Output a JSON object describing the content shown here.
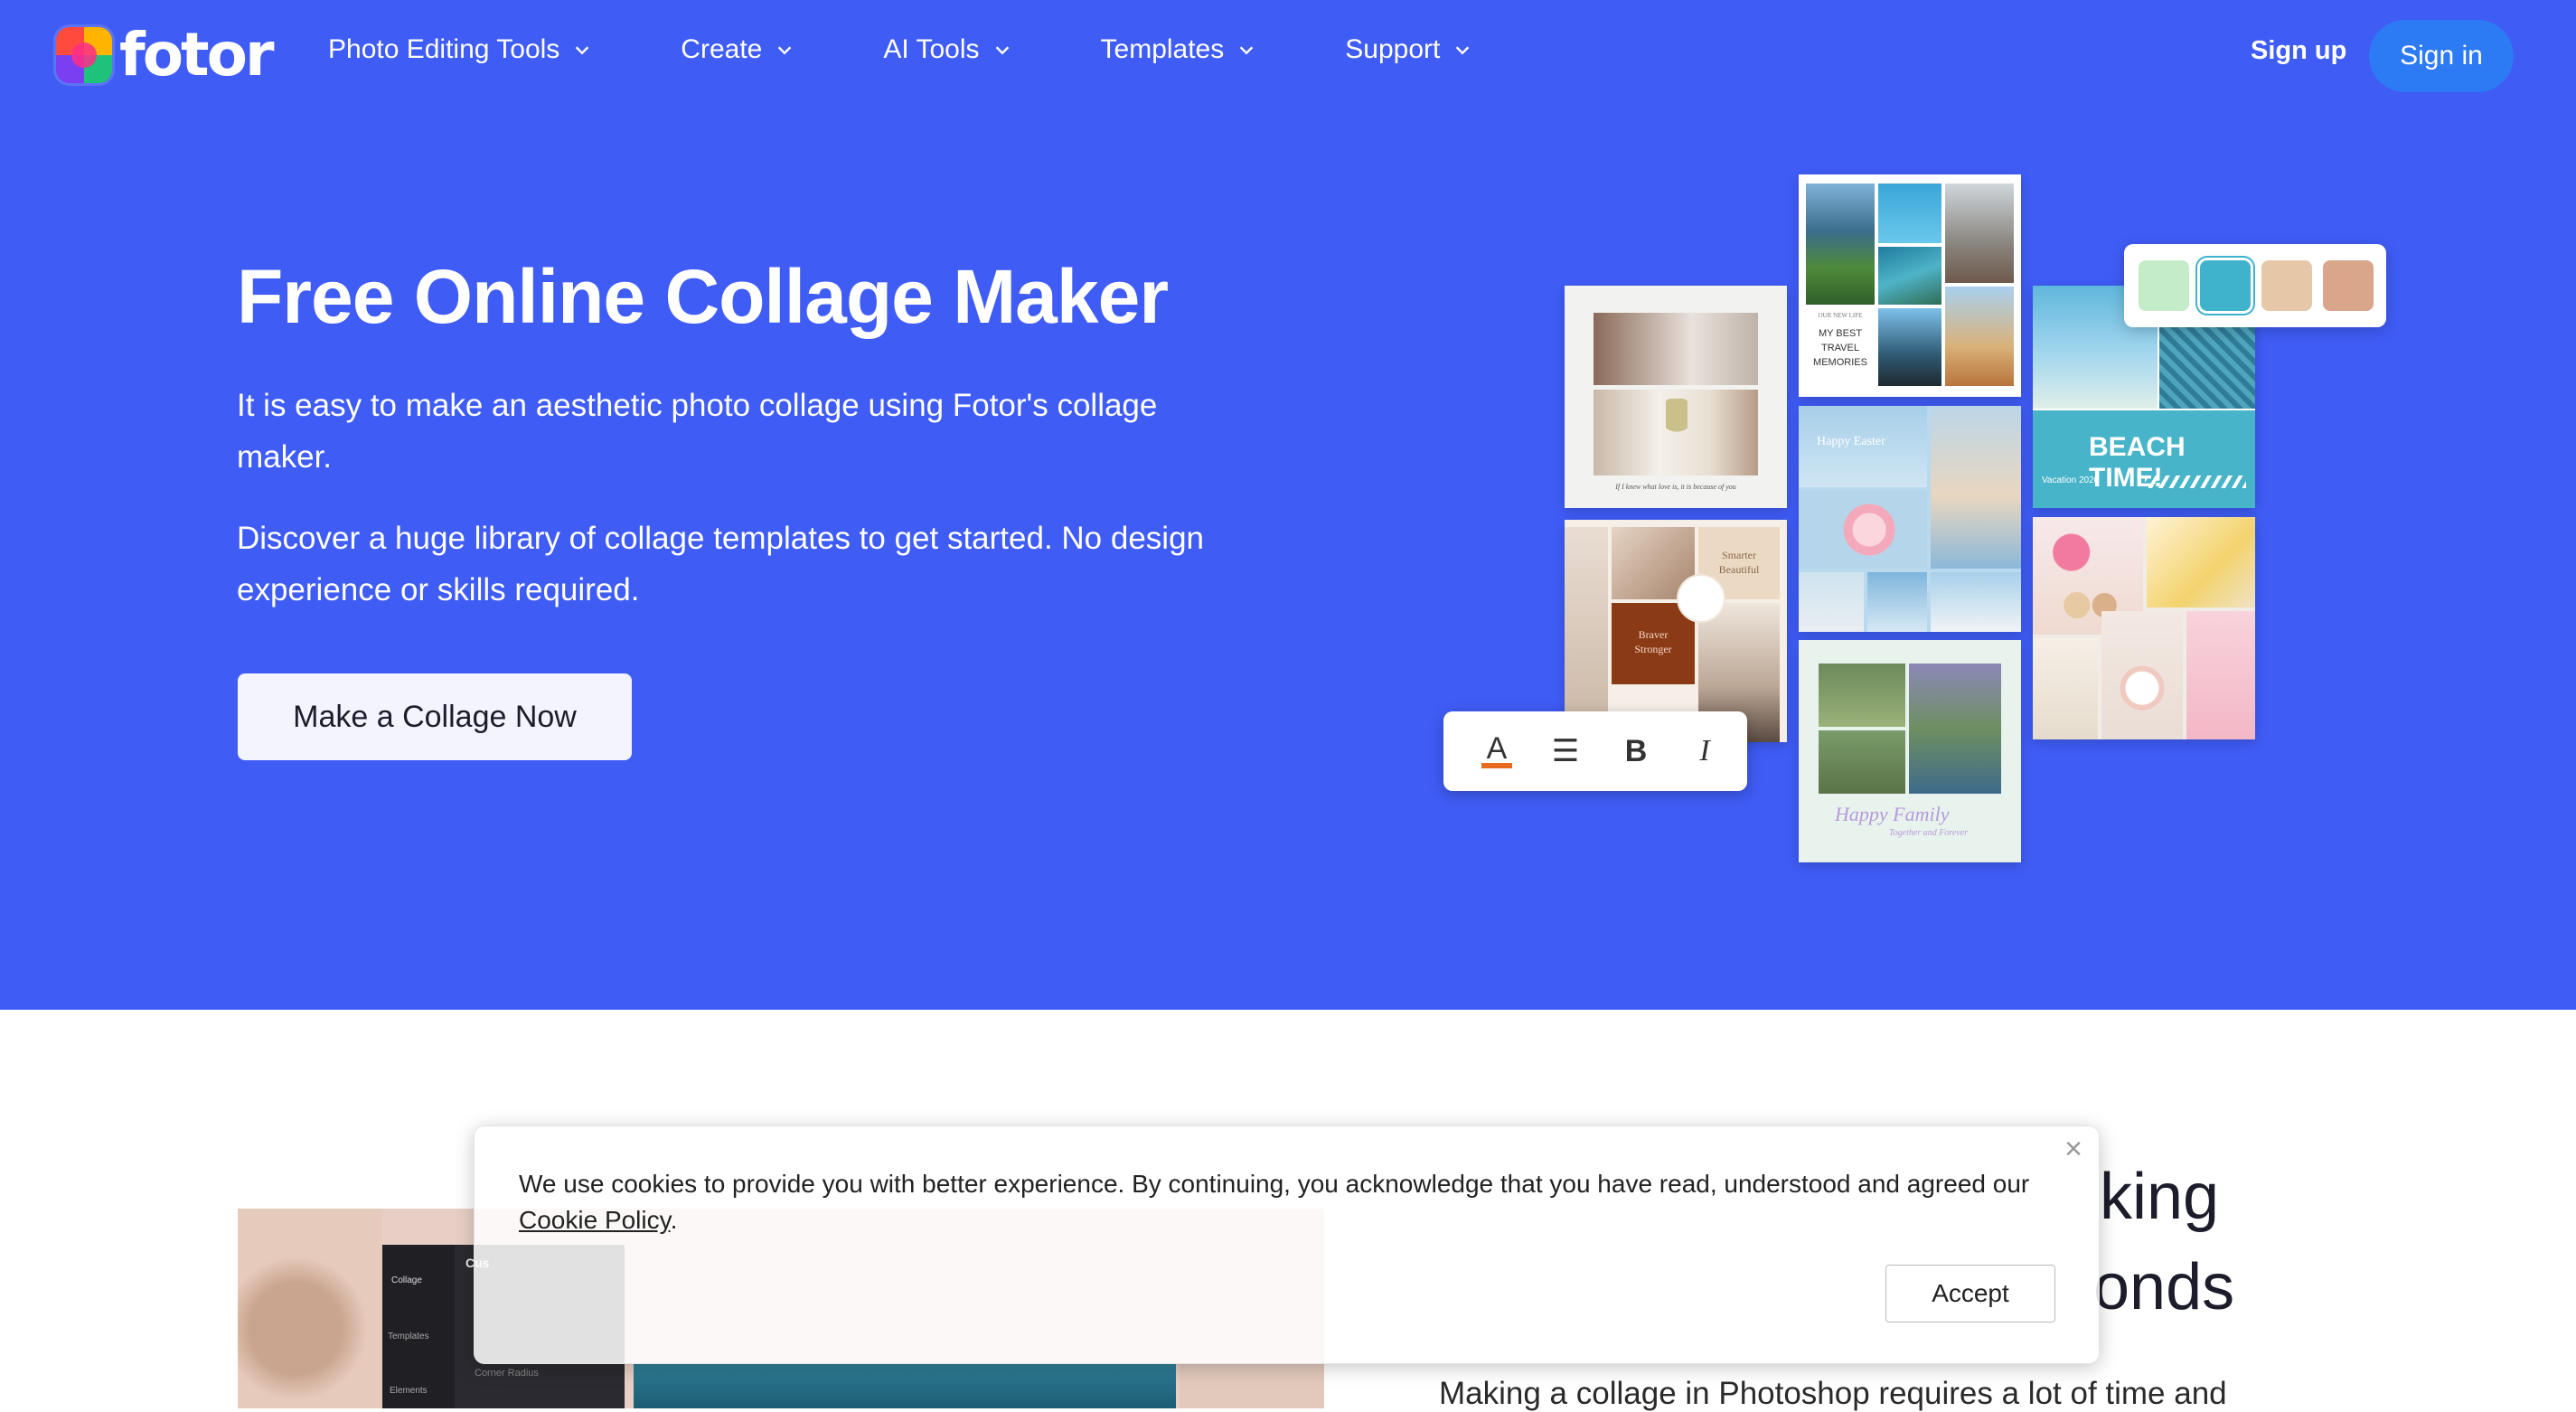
{
  "brand": {
    "name": "fotor",
    "text_color": "#ffffff",
    "hero_color": "#3f5cf5",
    "signin_color": "#2d7bf4"
  },
  "nav": {
    "items": [
      {
        "label": "Photo Editing Tools"
      },
      {
        "label": "Create"
      },
      {
        "label": "AI Tools"
      },
      {
        "label": "Templates"
      },
      {
        "label": "Support"
      }
    ],
    "signup_label": "Sign up",
    "signin_label": "Sign in"
  },
  "hero": {
    "title": "Free Online Collage Maker",
    "paragraph_1": "It is easy to make an aesthetic photo collage using Fotor's collage maker.",
    "paragraph_2": "Discover a huge library of collage templates to get started. No design experience or skills required.",
    "cta_label": "Make a Collage Now"
  },
  "collage": {
    "quote_text": "If I knew what love is, it is because of you",
    "travel_small": "OUR NEW LIFE",
    "travel_text_1": "MY BEST",
    "travel_text_2": "TRAVEL",
    "travel_text_3": "MEMORIES",
    "smarter_1": "Smarter",
    "smarter_2": "Beautiful",
    "braver_1": "Braver",
    "braver_2": "Stronger",
    "easter_text": "Happy Easter",
    "family_text": "Happy Family",
    "family_sub": "Together and Forever",
    "beach_title": "BEACH TIME!",
    "beach_sub": "Vacation 2020",
    "palette_colors": [
      "#c5ecc8",
      "#3fb2cc",
      "#e6c7a8",
      "#d9a58b"
    ],
    "format_icons": [
      "text-color-icon",
      "align-icon",
      "bold-icon",
      "italic-icon"
    ],
    "format_glyphs": [
      "A",
      "☰",
      "B",
      "I"
    ]
  },
  "lower": {
    "heading_line_1": "king",
    "heading_line_2": "onds",
    "body_partial": "Making a collage in Photoshop requires a lot of time and",
    "editor_tabs": [
      "Collage",
      "Templates",
      "Elements"
    ],
    "editor_panel_title": "Cus",
    "editor_panel_row": "Corner Radius"
  },
  "cookie": {
    "text": "We use cookies to provide you with better experience. By continuing, you acknowledge that you have read, understood and agreed our ",
    "link_text": "Cookie Policy",
    "text_end": ".",
    "accept_label": "Accept",
    "close_glyph": "×"
  }
}
